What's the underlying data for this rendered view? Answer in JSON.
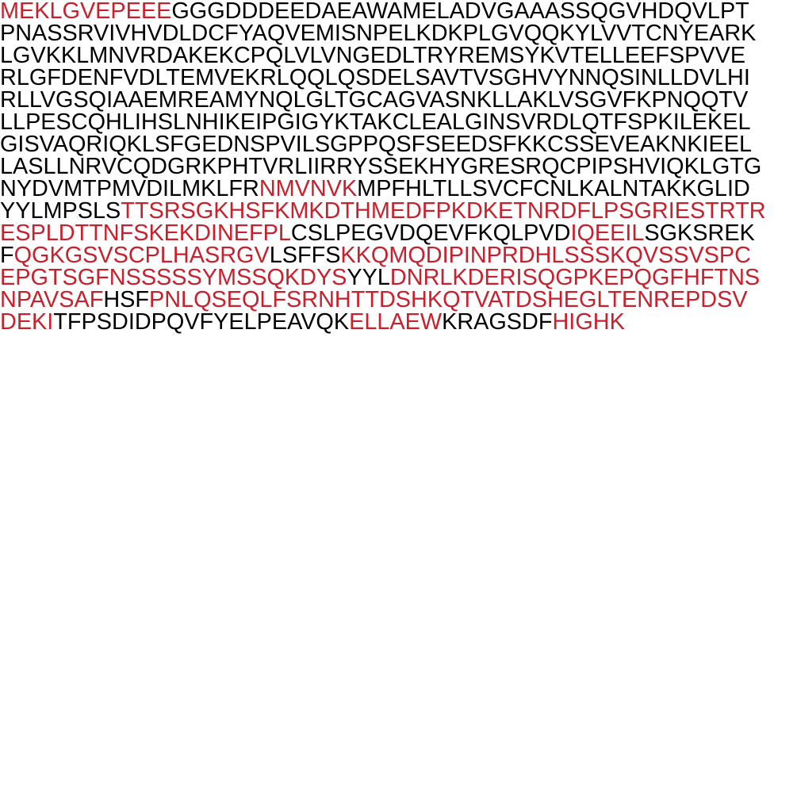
{
  "colors": {
    "highlight": "#c8202c",
    "normal": "#000000",
    "background": "#ffffff"
  },
  "sequence_lines": [
    [
      {
        "text": "MEKLGVEPEEE",
        "highlight": true
      },
      {
        "text": "GGGDDDEEDAEAWAMELADVGAAASSQGVHDQVLPT",
        "highlight": false
      }
    ],
    [
      {
        "text": "PNASSRVIVHVDLDCFYAQVEMISNPELKDKPLGVQQKYLVVTCNYEARK",
        "highlight": false
      }
    ],
    [
      {
        "text": "LGVKKLMNVRDAKEKCPQLVLVNGEDLTRYREMSYKVTELLEEFSPVVE",
        "highlight": false
      }
    ],
    [
      {
        "text": "RLGFDENFVDLTEMVEKRLQQLQSDELSAVTVSGHVYNNQSINLLDVLHI",
        "highlight": false
      }
    ],
    [
      {
        "text": "RLLVGSQIAAEMREAMYNQLGLTGCAGVASNKLLAKLVSGVFKPNQQTV",
        "highlight": false
      }
    ],
    [
      {
        "text": "LLPESCQHLIHSLNHIKEIPGIGYKTAKCLEALGINSVRDLQTFSPKILEKEL",
        "highlight": false
      }
    ],
    [
      {
        "text": "GISVAQRIQKLSFGEDNSPVILSGPPQSFSEEDSFKKCSSEVEAKNKIEEL",
        "highlight": false
      }
    ],
    [
      {
        "text": "LASLLNRVCQDGRKPHTVRLIIRRYSSEKHYGRESRQCPIPSHVIQKLGTG",
        "highlight": false
      }
    ],
    [
      {
        "text": "NYDVMTPMVDILMKLFR",
        "highlight": false
      },
      {
        "text": "NMVNVK",
        "highlight": true
      },
      {
        "text": "MPFHLTLLSVCFCNLKALNTAKKGLID",
        "highlight": false
      }
    ],
    [
      {
        "text": "YYLMPSLS",
        "highlight": false
      },
      {
        "text": "TTSRSGKHSFKMKDTHMEDFPKDKETNRDFLPSGRIESTRTR",
        "highlight": true
      }
    ],
    [
      {
        "text": "ESPLDTTNFSKEKDINEFPL",
        "highlight": true
      },
      {
        "text": "CSLPEGVDQEVFKQLPVD",
        "highlight": false
      },
      {
        "text": "IQEEIL",
        "highlight": true
      },
      {
        "text": "SGKSREK",
        "highlight": false
      }
    ],
    [
      {
        "text": "F",
        "highlight": false
      },
      {
        "text": "QGKGSVSCPLHASRGV",
        "highlight": true
      },
      {
        "text": "LSFFS",
        "highlight": false
      },
      {
        "text": "KKQMQDIPINPRDHLSSSKQVSSVSPC",
        "highlight": true
      }
    ],
    [
      {
        "text": "EPGTSGFNSSSSSYMSSQKDYS",
        "highlight": true
      },
      {
        "text": "YYL",
        "highlight": false
      },
      {
        "text": "DNRLKDERISQGPKEPQGFHFTNS",
        "highlight": true
      }
    ],
    [
      {
        "text": "NPAVSAF",
        "highlight": true
      },
      {
        "text": "HSF",
        "highlight": false
      },
      {
        "text": "PNLQSEQLFSRNHTTDSHKQTVATDSHEGLTENREPDSV",
        "highlight": true
      }
    ],
    [
      {
        "text": "DEKI",
        "highlight": true
      },
      {
        "text": "TFPSDIDPQVFYELPEAVQK",
        "highlight": false
      },
      {
        "text": "ELLAEW",
        "highlight": true
      },
      {
        "text": "KRAGSDF",
        "highlight": false
      },
      {
        "text": "HIGHK",
        "highlight": true
      }
    ]
  ]
}
